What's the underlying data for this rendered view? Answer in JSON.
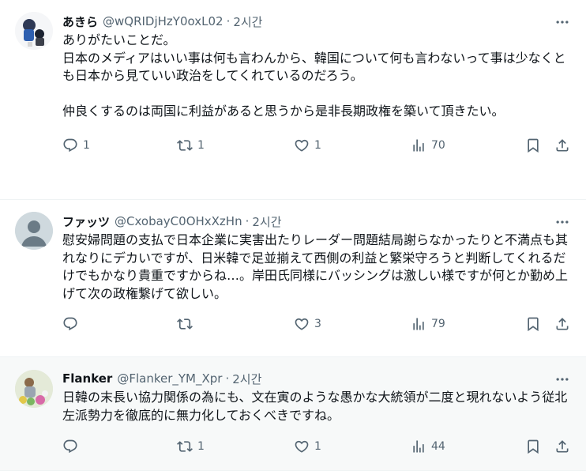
{
  "tweets": [
    {
      "name": "あきら",
      "handle": "@wQRIDjHzY0oxL02",
      "sep": "·",
      "time": "2시간",
      "text": "ありがたいことだ。\n日本のメディアはいい事は何も言わんから、韓国について何も言わないって事は少なくとも日本から見ていい政治をしてくれているのだろう。\n\n仲良くするのは両国に利益があると思うから是非長期政権を築いて頂きたい。",
      "replies": "1",
      "retweets": "1",
      "likes": "1",
      "views": "70"
    },
    {
      "name": "ファッツ",
      "handle": "@CxobayC0OHxXzHn",
      "sep": "·",
      "time": "2시간",
      "text": "慰安婦問題の支払で日本企業に実害出たりレーダー問題結局謝らなかったりと不満点も其れなりにデカいですが、日米韓で足並揃えて西側の利益と繁栄守ろうと判断してくれるだけでもかなり貴重ですからね…。岸田氏同様にバッシングは激しい様ですが何とか勤め上げて次の政権繋げて欲しい。",
      "replies": "",
      "retweets": "",
      "likes": "3",
      "views": "79"
    },
    {
      "name": "Flanker",
      "handle": "@Flanker_YM_Xpr",
      "sep": "·",
      "time": "2시간",
      "text": "日韓の末長い協力関係の為にも、文在寅のような愚かな大統領が二度と現れないよう従北左派勢力を徹底的に無力化しておくべきですね。",
      "replies": "",
      "retweets": "1",
      "likes": "1",
      "views": "44"
    }
  ],
  "colors": {
    "text": "#0f1419",
    "secondary": "#536471",
    "divider": "#eff3f4",
    "highlight_bg": "#f7f9f9"
  }
}
